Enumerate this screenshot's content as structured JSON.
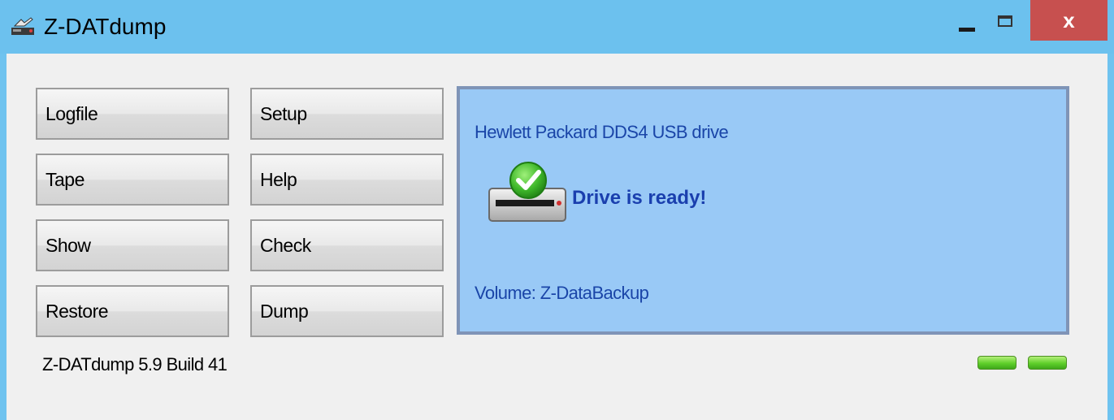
{
  "window": {
    "title": "Z-DATdump",
    "close_label": "x"
  },
  "buttons": {
    "logfile": "Logfile",
    "setup": "Setup",
    "tape": "Tape",
    "help": "Help",
    "show": "Show",
    "check": "Check",
    "restore": "Restore",
    "dump": "Dump"
  },
  "drive_panel": {
    "drive_name": "Hewlett Packard DDS4 USB drive",
    "status": "Drive is ready!",
    "volume": "Volume: Z-DataBackup",
    "status_icon": "drive-ready-check-icon"
  },
  "footer": {
    "version": "Z-DATdump 5.9 Build 41",
    "leds": [
      "green",
      "green"
    ]
  },
  "colors": {
    "titlebar": "#6cc1ee",
    "close_button": "#c7504f",
    "panel_background": "#99c9f6",
    "panel_text": "#1a45a8",
    "led_green": "#5fcf2a"
  }
}
